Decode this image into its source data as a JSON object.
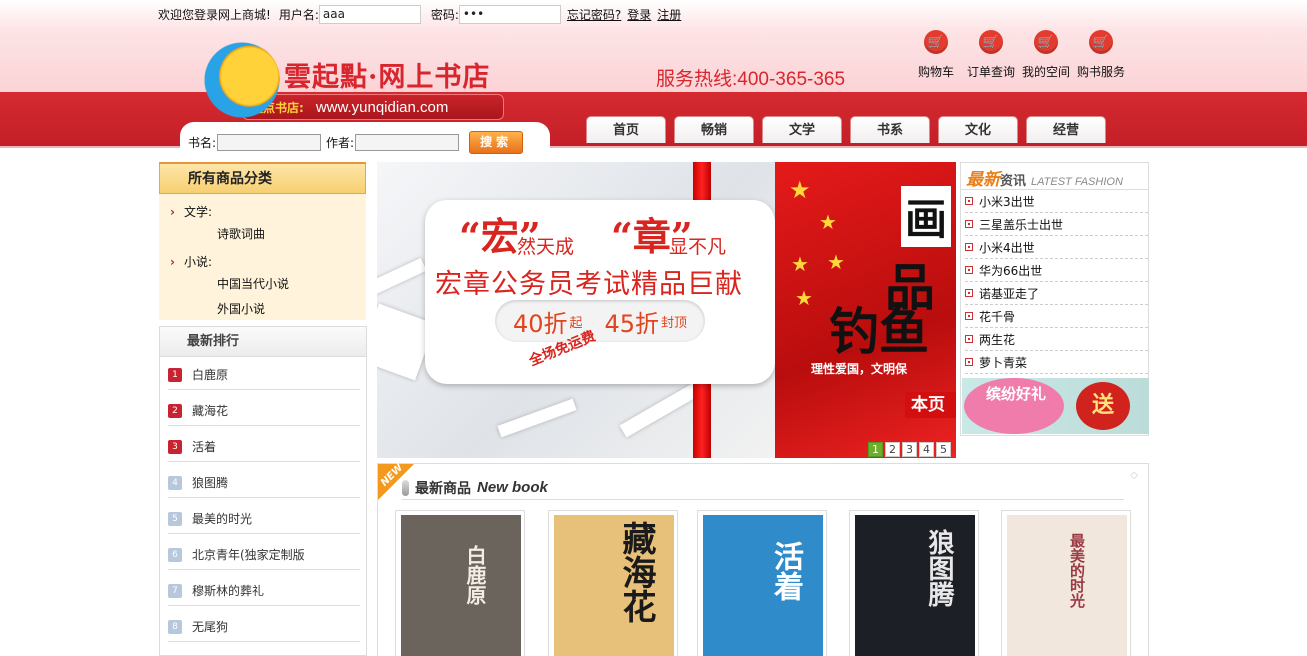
{
  "login": {
    "welcome": "欢迎您登录网上商城!",
    "username_label": "用户名:",
    "username_value": "aaa",
    "password_label": "密码:",
    "password_value": "•••",
    "forgot_link": "忘记密码?",
    "login_link": "登录",
    "register_link": "注册"
  },
  "brand": {
    "title": "雲起點·网上书店",
    "tag_left": "起点书店:",
    "tag_url": "www.yunqidian.com",
    "hotline": "服务热线:400-365-365"
  },
  "quick_links": [
    {
      "label": "购物车",
      "icon": "cart-icon"
    },
    {
      "label": "订单查询",
      "icon": "cart-icon"
    },
    {
      "label": "我的空间",
      "icon": "cart-icon"
    },
    {
      "label": "购书服务",
      "icon": "cart-icon"
    }
  ],
  "search": {
    "title_label": "书名:",
    "author_label": "作者:",
    "title_value": "",
    "author_value": "",
    "button": "搜索"
  },
  "nav": [
    "首页",
    "畅销",
    "文学",
    "书系",
    "文化",
    "经营"
  ],
  "categories": {
    "heading": "所有商品分类",
    "groups": [
      {
        "name": "文学:",
        "items": [
          "诗歌词曲"
        ]
      },
      {
        "name": "小说:",
        "items": [
          "中国当代小说",
          "外国小说"
        ]
      }
    ]
  },
  "ranking": {
    "heading": "最新排行",
    "items": [
      {
        "rank": "1",
        "title": "白鹿原"
      },
      {
        "rank": "2",
        "title": "藏海花"
      },
      {
        "rank": "3",
        "title": "活着"
      },
      {
        "rank": "4",
        "title": "狼图腾"
      },
      {
        "rank": "5",
        "title": "最美的时光"
      },
      {
        "rank": "6",
        "title": "北京青年(独家定制版"
      },
      {
        "rank": "7",
        "title": "穆斯林的葬礼"
      },
      {
        "rank": "8",
        "title": "无尾狗"
      }
    ]
  },
  "banner": {
    "q1": "“宏”",
    "s1": "然天成",
    "q2": "“章”",
    "s2": "显不凡",
    "main": "宏章公务员考试精品巨献",
    "disc1_num": "40折",
    "disc1_suffix": "起",
    "disc2_num": "45折",
    "disc2_suffix": "封顶",
    "free": "全场免运费",
    "right_1": "画",
    "right_2": "品",
    "right_3": "钓鱼",
    "right_4": "理性爱国，文明保",
    "right_5": "本页",
    "pages": [
      "1",
      "2",
      "3",
      "4",
      "5"
    ],
    "active_page": "1"
  },
  "news": {
    "heading_a": "最新",
    "heading_b": "资讯",
    "heading_c": "LATEST FASHION",
    "items": [
      "小米3出世",
      "三星盖乐士出世",
      "小米4出世",
      "华为66出世",
      "诺基亚走了",
      "花千骨",
      "两生花",
      "萝卜青菜"
    ],
    "ad_left": "缤纷好礼",
    "ad_right": "送"
  },
  "new_books": {
    "flag": "NEW",
    "heading_cn": "最新商品",
    "heading_en": "New book",
    "books": [
      {
        "title": "白鹿原",
        "cover_color": "#6b645d"
      },
      {
        "title": "藏海花",
        "cover_color": "#e7c07a"
      },
      {
        "title": "活着",
        "cover_color": "#2f8bc9"
      },
      {
        "title": "狼图腾",
        "cover_color": "#1c2026"
      },
      {
        "title": "最美的时光",
        "cover_color": "#f1e7dc"
      }
    ]
  }
}
